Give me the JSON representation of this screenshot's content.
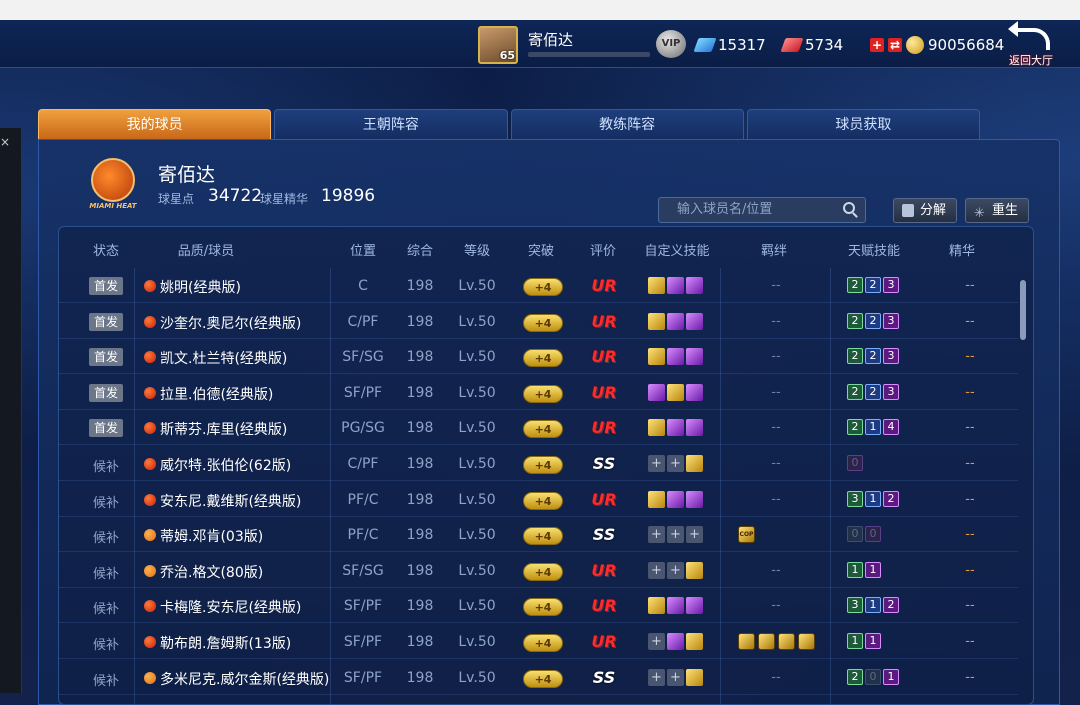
{
  "topbar": {
    "level": "65",
    "player_name": "寄佰达",
    "xp_fraction": 0,
    "vip_label": "VIP",
    "diamonds": "15317",
    "tickets": "5734",
    "gold": "90056684",
    "back_label": "返回大厅",
    "colors": {
      "accent": "#f0a040",
      "gold": "#d09a1a",
      "ur": "#ff2a2a"
    }
  },
  "tabs": [
    "我的球员",
    "王朝阵容",
    "教练阵容",
    "球员获取"
  ],
  "team": {
    "logo_text": "MIAMI HEAT",
    "owner_name": "寄佰达",
    "points_label": "球星点",
    "points_value": "34722",
    "essence_label": "球星精华",
    "essence_value": "19896"
  },
  "search": {
    "placeholder": "输入球员名/位置"
  },
  "buttons": {
    "decompose": "分解",
    "rebirth": "重生"
  },
  "headers": [
    "状态",
    "品质/球员",
    "位置",
    "综合",
    "等级",
    "突破",
    "评价",
    "自定义技能",
    "羁绊",
    "天赋技能",
    "精华"
  ],
  "players": [
    {
      "status": "首发",
      "starter": true,
      "ball": "red",
      "name": "姚明(经典版)",
      "pos": "C",
      "ovr": "198",
      "lv": "Lv.50",
      "brk": "+4",
      "grade": "UR",
      "skills": [
        "gold",
        "purple",
        "purple"
      ],
      "bond": "--",
      "bonds": [],
      "talents": [
        [
          "2",
          "green"
        ],
        [
          "2",
          "blue"
        ],
        [
          "3",
          "purple"
        ]
      ],
      "essence": "--"
    },
    {
      "status": "首发",
      "starter": true,
      "ball": "red",
      "name": "沙奎尔.奥尼尔(经典版)",
      "pos": "C/PF",
      "ovr": "198",
      "lv": "Lv.50",
      "brk": "+4",
      "grade": "UR",
      "skills": [
        "gold",
        "purple",
        "purple"
      ],
      "bond": "--",
      "bonds": [],
      "talents": [
        [
          "2",
          "green"
        ],
        [
          "2",
          "blue"
        ],
        [
          "3",
          "purple"
        ]
      ],
      "essence": "--"
    },
    {
      "status": "首发",
      "starter": true,
      "ball": "red",
      "name": "凯文.杜兰特(经典版)",
      "pos": "SF/SG",
      "ovr": "198",
      "lv": "Lv.50",
      "brk": "+4",
      "grade": "UR",
      "skills": [
        "gold",
        "purple",
        "purple"
      ],
      "bond": "--",
      "bonds": [],
      "talents": [
        [
          "2",
          "green"
        ],
        [
          "2",
          "blue"
        ],
        [
          "3",
          "purple"
        ]
      ],
      "essence": "--"
    },
    {
      "status": "首发",
      "starter": true,
      "ball": "red",
      "name": "拉里.伯德(经典版)",
      "pos": "SF/PF",
      "ovr": "198",
      "lv": "Lv.50",
      "brk": "+4",
      "grade": "UR",
      "skills": [
        "purple",
        "gold",
        "purple"
      ],
      "bond": "--",
      "bonds": [],
      "talents": [
        [
          "2",
          "green"
        ],
        [
          "2",
          "blue"
        ],
        [
          "3",
          "purple"
        ]
      ],
      "essence": "--"
    },
    {
      "status": "首发",
      "starter": true,
      "ball": "red",
      "name": "斯蒂芬.库里(经典版)",
      "pos": "PG/SG",
      "ovr": "198",
      "lv": "Lv.50",
      "brk": "+4",
      "grade": "UR",
      "skills": [
        "gold",
        "purple",
        "purple"
      ],
      "bond": "--",
      "bonds": [],
      "talents": [
        [
          "2",
          "green"
        ],
        [
          "1",
          "blue"
        ],
        [
          "4",
          "purple"
        ]
      ],
      "essence": "--"
    },
    {
      "status": "候补",
      "starter": false,
      "ball": "red",
      "name": "威尔特.张伯伦(62版)",
      "pos": "C/PF",
      "ovr": "198",
      "lv": "Lv.50",
      "brk": "+4",
      "grade": "SS",
      "skills": [
        "empty",
        "empty",
        "gold"
      ],
      "bond": "--",
      "bonds": [],
      "talents": [
        [
          "0",
          "dimp"
        ]
      ],
      "essence": "--"
    },
    {
      "status": "候补",
      "starter": false,
      "ball": "red",
      "name": "安东尼.戴维斯(经典版)",
      "pos": "PF/C",
      "ovr": "198",
      "lv": "Lv.50",
      "brk": "+4",
      "grade": "UR",
      "skills": [
        "gold",
        "purple",
        "purple"
      ],
      "bond": "--",
      "bonds": [],
      "talents": [
        [
          "3",
          "green"
        ],
        [
          "1",
          "blue"
        ],
        [
          "2",
          "purple"
        ]
      ],
      "essence": "--"
    },
    {
      "status": "候补",
      "starter": false,
      "ball": "orange",
      "name": "蒂姆.邓肯(03版)",
      "pos": "PF/C",
      "ovr": "198",
      "lv": "Lv.50",
      "brk": "+4",
      "grade": "SS",
      "skills": [
        "empty",
        "empty",
        "empty"
      ],
      "bond": "",
      "bonds": [
        "COP"
      ],
      "talents": [
        [
          "0",
          "dim"
        ],
        [
          "0",
          "dimp"
        ]
      ],
      "essence": "--"
    },
    {
      "status": "候补",
      "starter": false,
      "ball": "orange",
      "name": "乔治.格文(80版)",
      "pos": "SF/SG",
      "ovr": "198",
      "lv": "Lv.50",
      "brk": "+4",
      "grade": "UR",
      "skills": [
        "empty",
        "empty",
        "gold"
      ],
      "bond": "--",
      "bonds": [],
      "talents": [
        [
          "1",
          "green"
        ],
        [
          "1",
          "purple"
        ]
      ],
      "essence": "--"
    },
    {
      "status": "候补",
      "starter": false,
      "ball": "red",
      "name": "卡梅隆.安东尼(经典版)",
      "pos": "SF/PF",
      "ovr": "198",
      "lv": "Lv.50",
      "brk": "+4",
      "grade": "UR",
      "skills": [
        "gold",
        "purple",
        "purple"
      ],
      "bond": "--",
      "bonds": [],
      "talents": [
        [
          "3",
          "green"
        ],
        [
          "1",
          "blue"
        ],
        [
          "2",
          "purple"
        ]
      ],
      "essence": "--"
    },
    {
      "status": "候补",
      "starter": false,
      "ball": "red",
      "name": "勒布朗.詹姆斯(13版)",
      "pos": "SF/PF",
      "ovr": "198",
      "lv": "Lv.50",
      "brk": "+4",
      "grade": "UR",
      "skills": [
        "empty",
        "purple",
        "gold"
      ],
      "bond": "",
      "bonds": [
        "",
        "",
        "",
        ""
      ],
      "talents": [
        [
          "1",
          "green"
        ],
        [
          "1",
          "purple"
        ]
      ],
      "essence": "--"
    },
    {
      "status": "候补",
      "starter": false,
      "ball": "orange",
      "name": "多米尼克.威尔金斯(经典版)",
      "pos": "SF/PF",
      "ovr": "198",
      "lv": "Lv.50",
      "brk": "+4",
      "grade": "SS",
      "skills": [
        "empty",
        "empty",
        "gold"
      ],
      "bond": "--",
      "bonds": [],
      "talents": [
        [
          "2",
          "green"
        ],
        [
          "0",
          "dim"
        ],
        [
          "1",
          "purple"
        ]
      ],
      "essence": "--"
    }
  ]
}
